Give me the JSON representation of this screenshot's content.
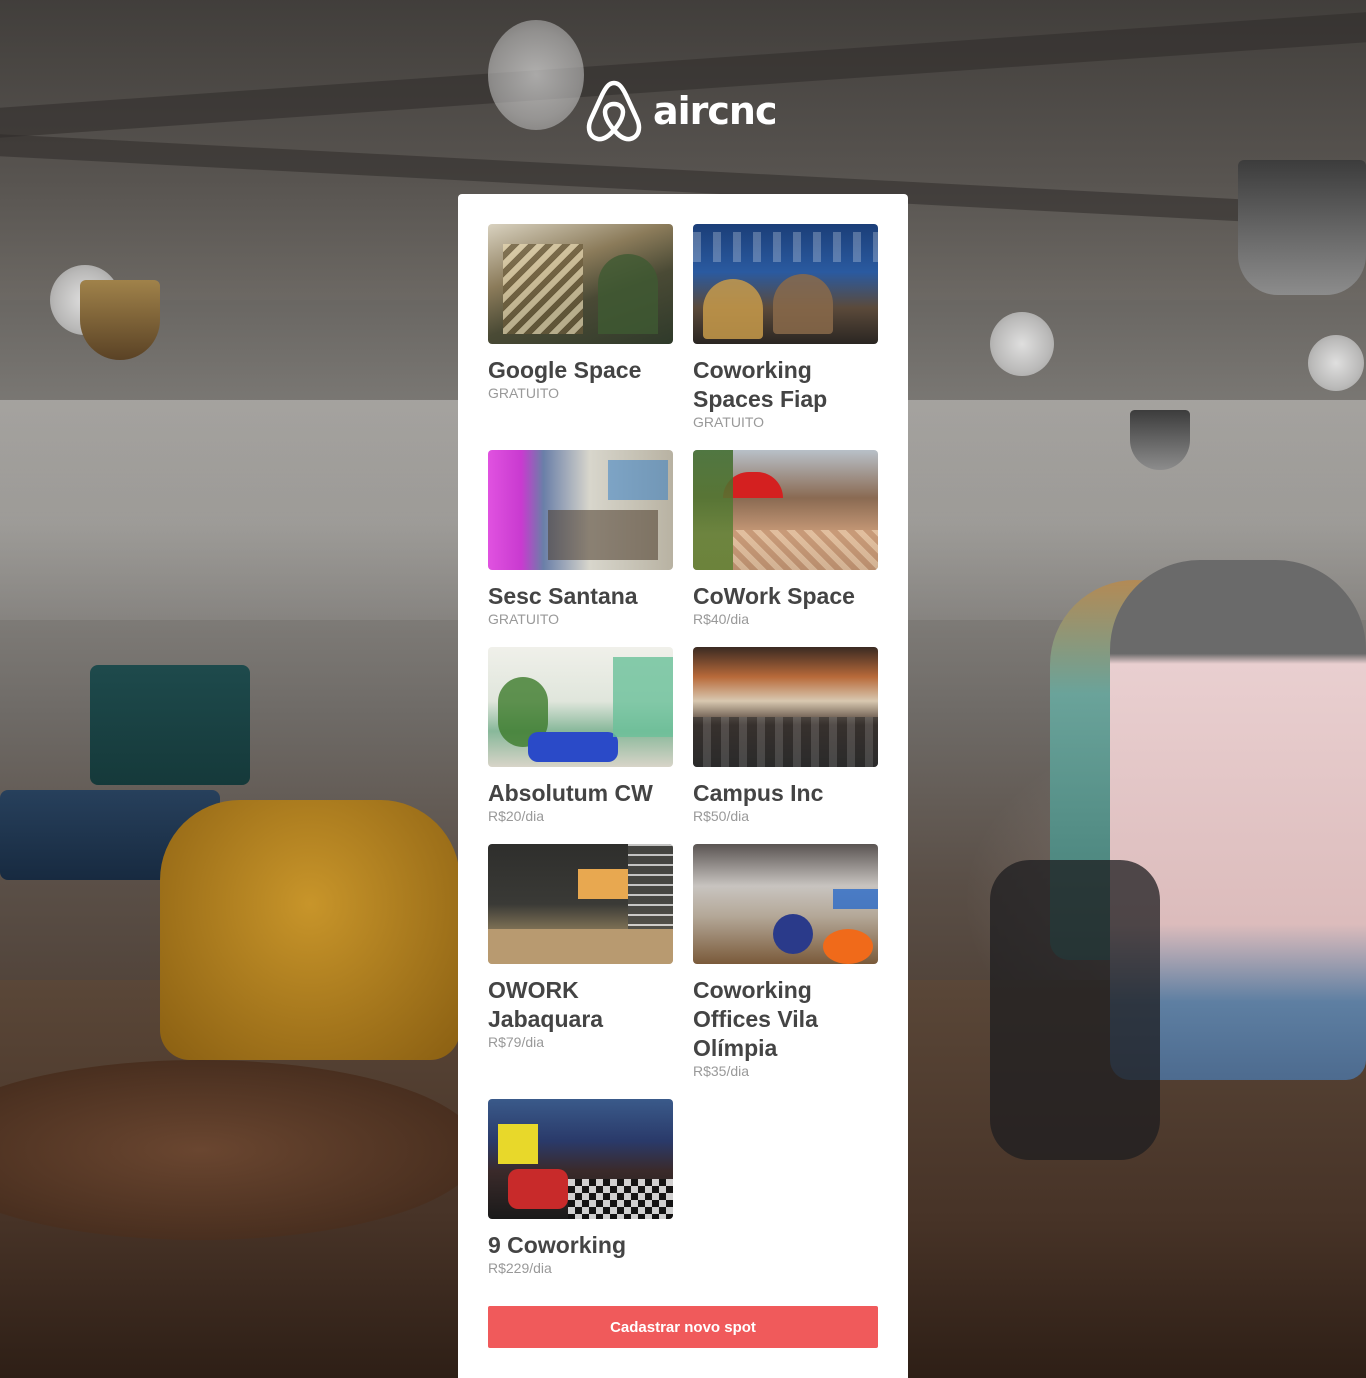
{
  "brand": {
    "name": "aircnc",
    "logo_icon": "airbnb-belo-icon"
  },
  "colors": {
    "accent": "#f05a5b",
    "title_text": "#444444",
    "price_text": "#999999"
  },
  "spots": [
    {
      "title": "Google Space",
      "price": "GRATUITO"
    },
    {
      "title": "Coworking Spaces Fiap",
      "price": "GRATUITO"
    },
    {
      "title": "Sesc Santana",
      "price": "GRATUITO"
    },
    {
      "title": "CoWork Space",
      "price": "R$40/dia"
    },
    {
      "title": "Absolutum CW",
      "price": "R$20/dia"
    },
    {
      "title": "Campus Inc",
      "price": "R$50/dia"
    },
    {
      "title": "OWORK Jabaquara",
      "price": "R$79/dia"
    },
    {
      "title": "Coworking Offices Vila Olímpia",
      "price": "R$35/dia"
    },
    {
      "title": "9 Coworking",
      "price": "R$229/dia"
    }
  ],
  "actions": {
    "new_spot_label": "Cadastrar novo spot"
  }
}
